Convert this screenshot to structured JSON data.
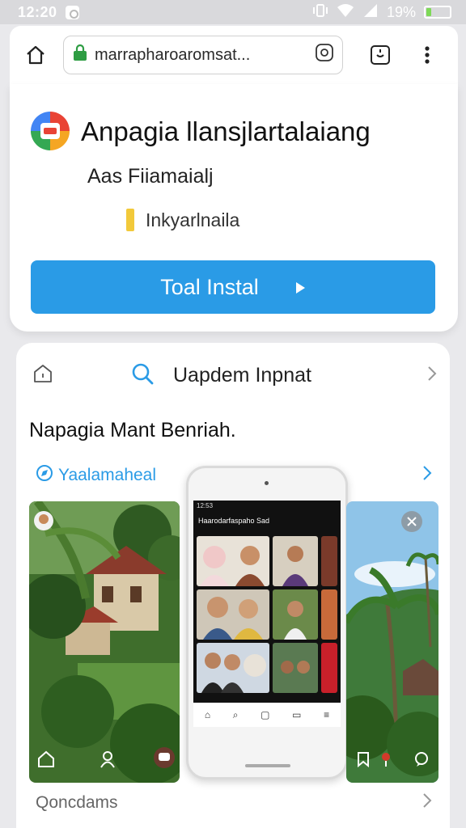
{
  "status_bar": {
    "time": "12:20",
    "battery": "19%",
    "battery_level": 0.19,
    "icons": [
      "notification-icon",
      "vibrate-icon",
      "wifi-icon",
      "signal-icon",
      "battery-icon"
    ]
  },
  "browser": {
    "url": "marrapharoaromsat...",
    "icons": [
      "home-icon",
      "lock-icon",
      "tab-icon",
      "tabs-switcher-icon",
      "overflow-menu-icon"
    ]
  },
  "app": {
    "title": "Anpagia llansjlartalaiang",
    "subtitle": "Aas Fiiamaialj",
    "rating_label": "Inkyarlnaila",
    "install_label": "Toal Instal",
    "accent": "#2a9be6",
    "rating_color": "#f2c93a"
  },
  "updates": {
    "title": "Uapdem Inpnat",
    "description": "Napagia Mant Benriah.",
    "tag_label": "Yaalamaheal",
    "footer_label": "Qoncdams"
  },
  "phone_preview": {
    "status_time": "12:53",
    "header": "Haarodarfaspaho Sad"
  }
}
